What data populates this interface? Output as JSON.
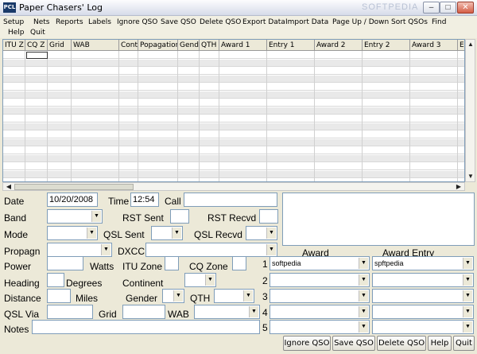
{
  "window": {
    "title": "Paper Chasers' Log",
    "app_icon_text": "PCL",
    "watermark": "SOFTPEDIA"
  },
  "menu": [
    "Setup",
    "Nets",
    "Reports",
    "Labels",
    "Ignore QSO",
    "Save QSO",
    "Delete QSO",
    "Export Data",
    "Import Data",
    "Page Up / Down",
    "Sort QSOs",
    "Find",
    "Help",
    "Quit"
  ],
  "grid": {
    "columns": [
      "ITU Z",
      "CQ Z",
      "Grid",
      "WAB",
      "Cont",
      "Popagation",
      "Gend",
      "QTH",
      "Award 1",
      "Entry 1",
      "Award 2",
      "Entry 2",
      "Award 3",
      "E"
    ],
    "row_count": 17
  },
  "form": {
    "date_label": "Date",
    "date_value": "10/20/2008",
    "time_label": "Time",
    "time_value": "12:54",
    "call_label": "Call",
    "call_value": "",
    "band_label": "Band",
    "band_value": "",
    "rst_sent_label": "RST Sent",
    "rst_recvd_label": "RST Recvd",
    "mode_label": "Mode",
    "mode_value": "",
    "qsl_sent_label": "QSL Sent",
    "qsl_recvd_label": "QSL Recvd",
    "propagn_label": "Propagn",
    "dxcc_label": "DXCC",
    "power_label": "Power",
    "watts_label": "Watts",
    "itu_zone_label": "ITU Zone",
    "cq_zone_label": "CQ Zone",
    "heading_label": "Heading",
    "degrees_label": "Degrees",
    "continent_label": "Continent",
    "distance_label": "Distance",
    "miles_label": "Miles",
    "gender_label": "Gender",
    "qth_label": "QTH",
    "qsl_via_label": "QSL Via",
    "grid_label": "Grid",
    "wab_label": "WAB",
    "notes_label": "Notes"
  },
  "awards": {
    "award_header": "Award",
    "entry_header": "Award Entry",
    "rows": [
      {
        "num": "1",
        "award": "softpedia",
        "entry": "spftpedia"
      },
      {
        "num": "2",
        "award": "",
        "entry": ""
      },
      {
        "num": "3",
        "award": "",
        "entry": ""
      },
      {
        "num": "4",
        "award": "",
        "entry": ""
      },
      {
        "num": "5",
        "award": "",
        "entry": ""
      }
    ]
  },
  "buttons": {
    "ignore": "Ignore QSO",
    "save": "Save QSO",
    "delete": "Delete QSO",
    "help": "Help",
    "quit": "Quit"
  }
}
